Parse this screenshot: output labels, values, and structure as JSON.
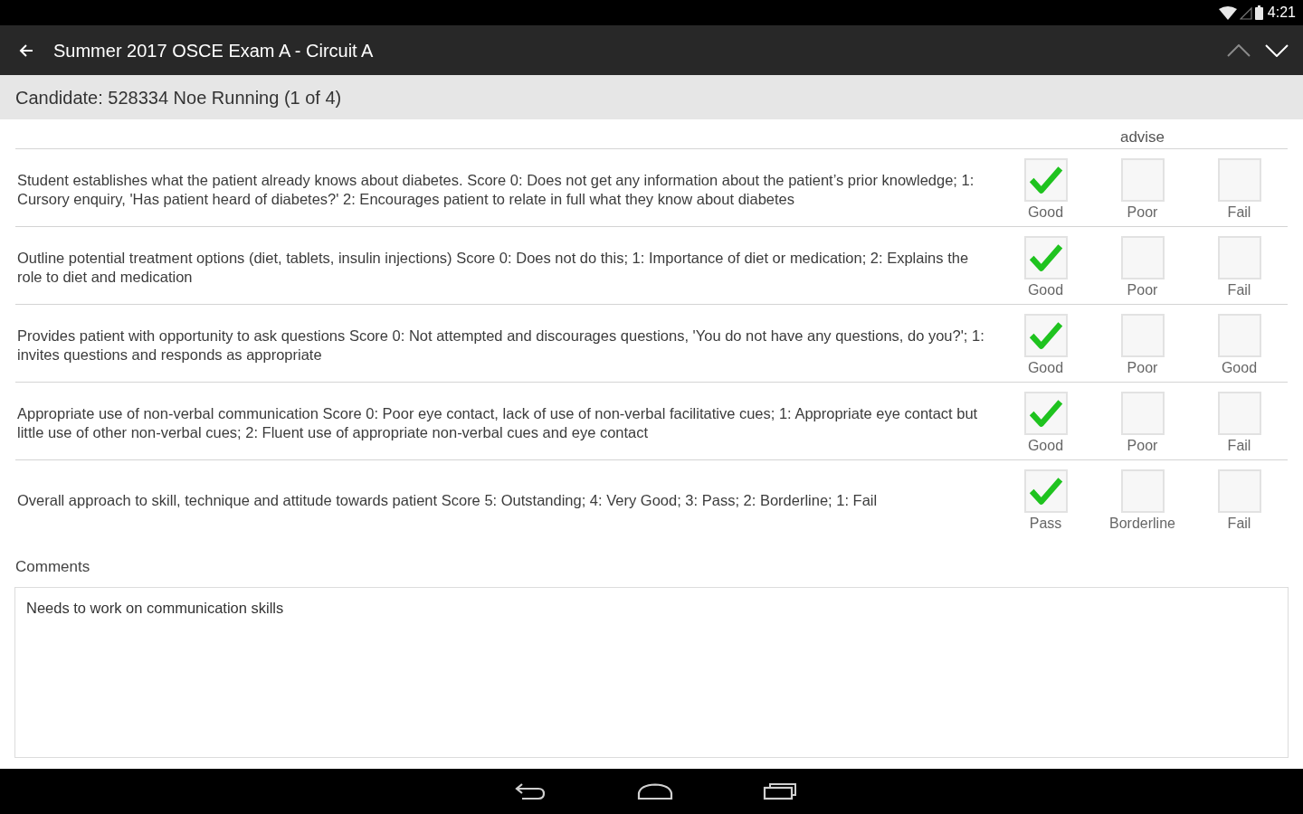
{
  "status_bar": {
    "time": "4:21"
  },
  "toolbar": {
    "title": "Summer 2017 OSCE Exam A - Circuit A",
    "previous": {
      "disabled": true
    },
    "next": {
      "disabled": false
    }
  },
  "candidate_bar": {
    "text": "Candidate: 528334 Noe Running (1 of 4)"
  },
  "table": {
    "column_2_heading": "advise",
    "rows": [
      {
        "criterion": "Student establishes what the patient already knows about diabetes. Score 0: Does not get any information about the patient’s prior knowledge; 1: Cursory enquiry, 'Has patient heard of diabetes?' 2: Encourages patient to relate in full what they know about diabetes",
        "options": [
          {
            "label": "Good",
            "checked": true
          },
          {
            "label": "Poor",
            "checked": false
          },
          {
            "label": "Fail",
            "checked": false
          }
        ]
      },
      {
        "criterion": "Outline potential treatment options (diet, tablets, insulin injections) Score 0: Does not do this; 1: Importance of diet or medication; 2: Explains the role to diet and medication",
        "options": [
          {
            "label": "Good",
            "checked": true
          },
          {
            "label": "Poor",
            "checked": false
          },
          {
            "label": "Fail",
            "checked": false
          }
        ]
      },
      {
        "criterion": "Provides patient with opportunity to ask questions Score 0: Not attempted and discourages questions, 'You do not have any questions, do you?'; 1: invites questions and responds as appropriate",
        "options": [
          {
            "label": "Good",
            "checked": true
          },
          {
            "label": "Poor",
            "checked": false
          },
          {
            "label": "Good",
            "checked": false
          }
        ]
      },
      {
        "criterion": "Appropriate use of non-verbal communication Score 0: Poor eye contact, lack of use of non-verbal facilitative cues; 1: Appropriate eye contact but little use of other non-verbal cues; 2: Fluent use of appropriate non-verbal cues and eye contact",
        "options": [
          {
            "label": "Good",
            "checked": true
          },
          {
            "label": "Poor",
            "checked": false
          },
          {
            "label": "Fail",
            "checked": false
          }
        ]
      },
      {
        "criterion": "Overall approach to skill, technique and attitude towards patient Score 5: Outstanding; 4: Very Good; 3: Pass; 2: Borderline; 1: Fail",
        "options": [
          {
            "label": "Pass",
            "checked": true
          },
          {
            "label": "Borderline",
            "checked": false
          },
          {
            "label": "Fail",
            "checked": false
          }
        ]
      }
    ]
  },
  "comments": {
    "label": "Comments",
    "value": "Needs to work on communication skills"
  }
}
